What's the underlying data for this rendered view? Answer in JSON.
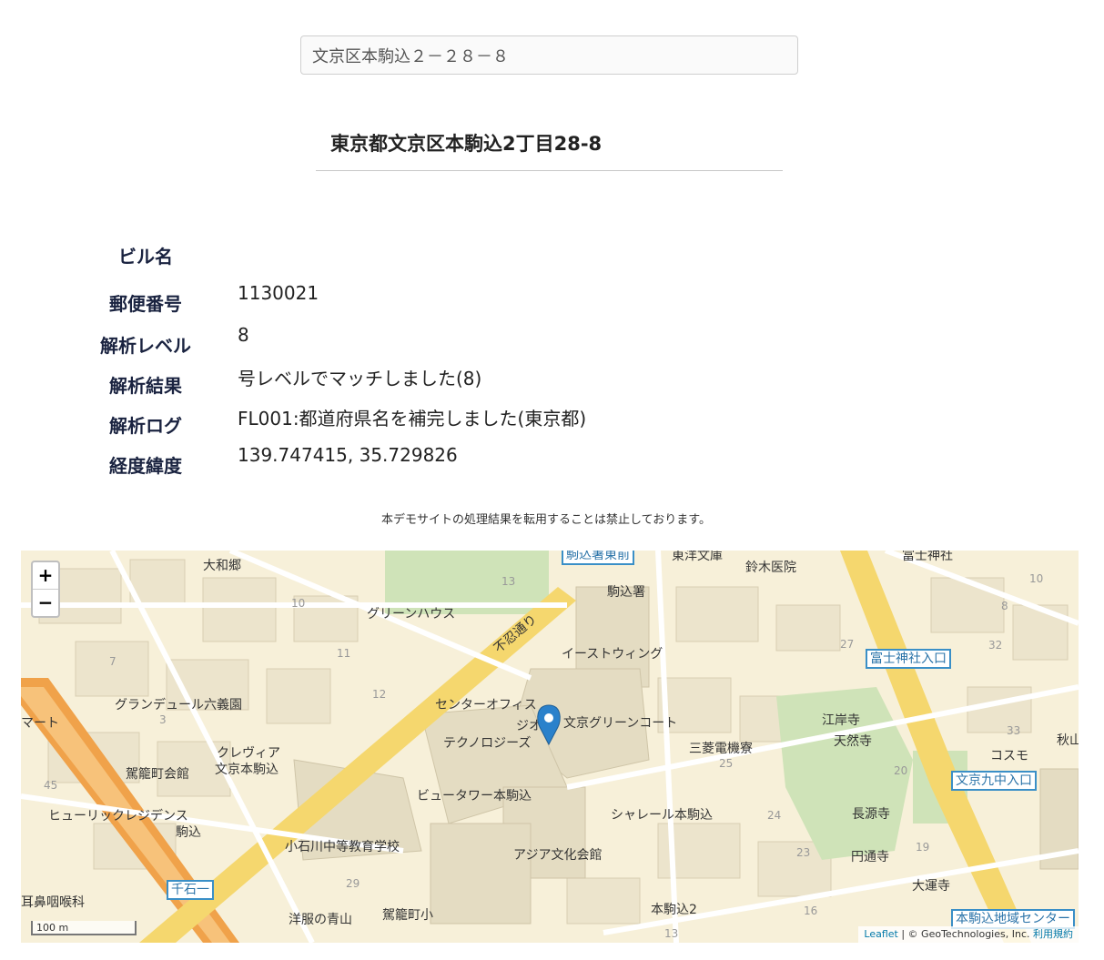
{
  "search": {
    "value": "文京区本駒込２－２８－８"
  },
  "result": {
    "title": "東京都文京区本駒込2丁目28-8"
  },
  "info": [
    {
      "label": "ビル名",
      "value": ""
    },
    {
      "label": "郵便番号",
      "value": "1130021"
    },
    {
      "label": "解析レベル",
      "value": "8"
    },
    {
      "label": "解析結果",
      "value": "号レベルでマッチしました(8)"
    },
    {
      "label": "解析ログ",
      "value": "FL001:都道府県名を補完しました(東京都)"
    },
    {
      "label": "経度緯度",
      "value": "139.747415, 35.729826"
    }
  ],
  "notice": "本デモサイトの処理結果を転用することは禁止しております。",
  "map": {
    "zoom_in": "+",
    "zoom_out": "−",
    "scale": "100 m",
    "attribution": {
      "leaflet": "Leaflet",
      "sep": " | © GeoTechnologies, Inc. ",
      "terms": "利用規約"
    },
    "labels": {
      "l1": "大和郷",
      "l2": "グリーンハウス",
      "l3": "不忍通り",
      "l4": "駒込署",
      "l5": "鈴木医院",
      "l6": "イーストウィング",
      "l7": "グランデュール六義園",
      "l8": "センターオフィス",
      "l9": "文京グリーンコート",
      "l10": "テクノロジーズ",
      "l11": "三菱電機寮",
      "l12": "江岸寺",
      "l13": "天然寺",
      "l14": "コスモ",
      "l15": "クレヴィア",
      "l16": "文京本駒込",
      "l17": "駕籠町会館",
      "l18": "ビュータワー本駒込",
      "l19": "ヒューリックレジデンス",
      "l20": "駒込",
      "l21": "シャレール本駒込",
      "l22": "長源寺",
      "l23": "小石川中等教育学校",
      "l24": "アジア文化会館",
      "l25": "円通寺",
      "l26": "大運寺",
      "l27": "洋服の青山",
      "l28": "駕籠町小",
      "l29": "本駒込2",
      "l30": "耳鼻咽喉科",
      "l31": "マート",
      "l32": "東洋文庫",
      "l33": "富士神社",
      "l34": "秋山",
      "l35": "ジオ"
    },
    "signs": {
      "s1": "富士神社入口",
      "s2": "文京九中入口",
      "s3": "千石一",
      "s4": "本駒込地域センター",
      "s5": "駒込署東前"
    },
    "colors": {
      "land": "#f7f0d9",
      "road_major": "#f5d76e",
      "road_orange": "#f0a24a",
      "park": "#cfe3b8",
      "building": "#e9e1c8",
      "marker": "#2a81cb"
    }
  }
}
